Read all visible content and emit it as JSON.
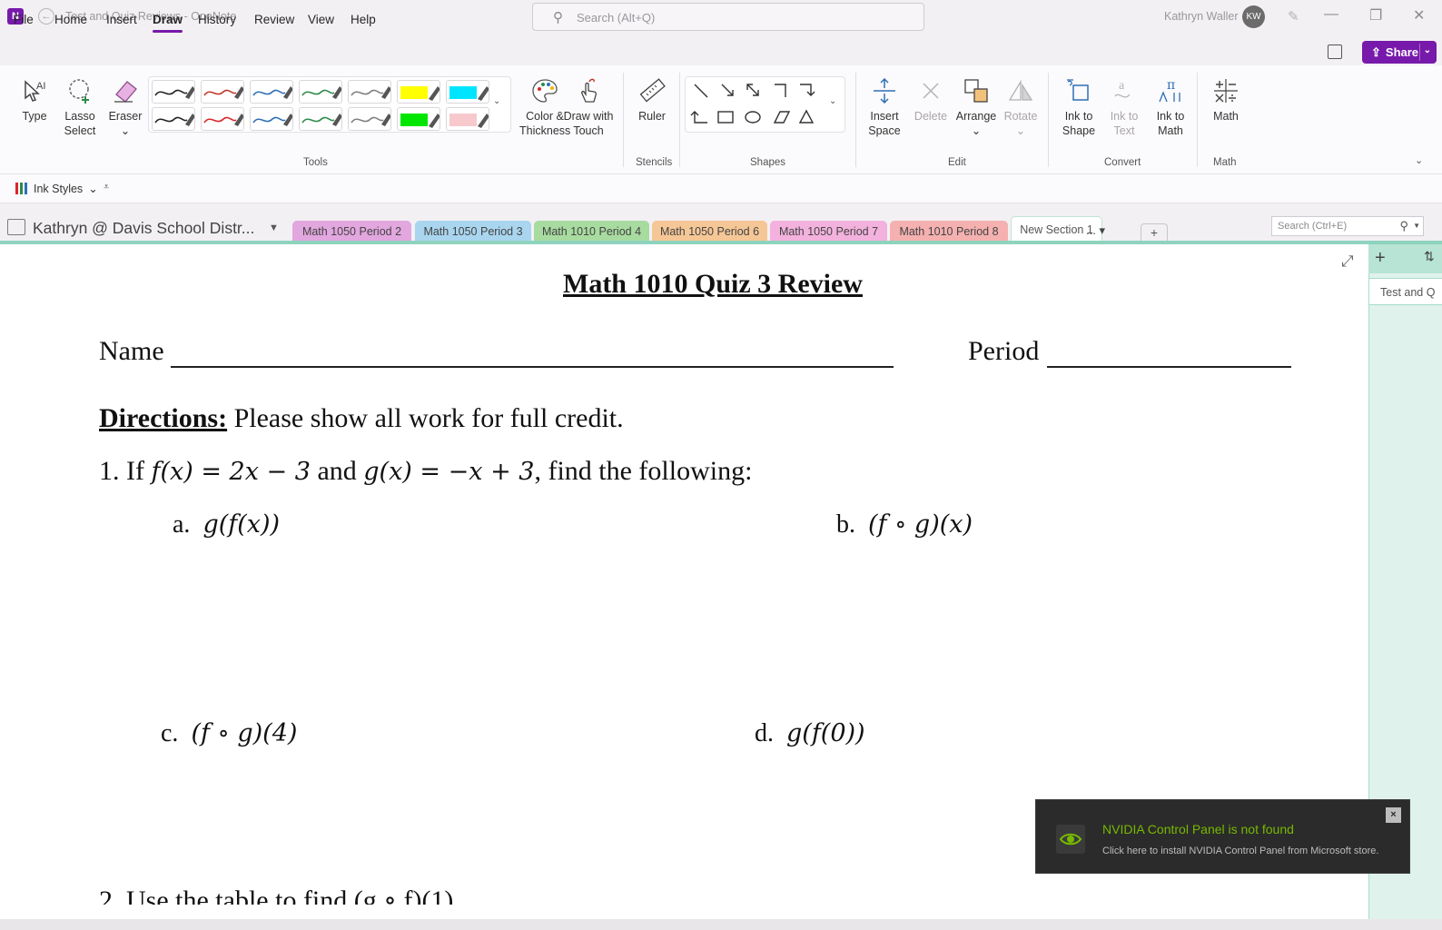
{
  "window": {
    "title": "Test and Quiz Reviews - OneNote",
    "app_icon_letter": "N",
    "search_placeholder": "Search (Alt+Q)",
    "user_name": "Kathryn Waller",
    "user_initials": "KW"
  },
  "menu": {
    "items": [
      "File",
      "Home",
      "Insert",
      "Draw",
      "History",
      "Review",
      "View",
      "Help"
    ],
    "active": "Draw",
    "share_label": "Share"
  },
  "ribbon": {
    "tools": {
      "type_label": "Type",
      "lasso_label": "Lasso Select",
      "eraser_label": "Eraser",
      "group_label": "Tools",
      "pens": [
        {
          "color": "#222222"
        },
        {
          "color": "#c0392b"
        },
        {
          "color": "#2e6fb5"
        },
        {
          "color": "#2d8a4a"
        },
        {
          "color": "#7f7f7f"
        },
        {
          "color": "#ffff00",
          "highlighter": true
        },
        {
          "color": "#00e5ff",
          "highlighter": true
        },
        {
          "color": "#222222"
        },
        {
          "color": "#d9262b"
        },
        {
          "color": "#2e6fb5"
        },
        {
          "color": "#2d8a4a"
        },
        {
          "color": "#7f7f7f"
        },
        {
          "color": "#00e600",
          "highlighter": true
        },
        {
          "color": "#f7c9cd",
          "highlighter": true
        }
      ],
      "color_thickness_label": "Color & Thickness",
      "draw_touch_label": "Draw with Touch"
    },
    "stencils": {
      "ruler_label": "Ruler",
      "group_label": "Stencils"
    },
    "shapes": {
      "group_label": "Shapes"
    },
    "edit": {
      "insert_space_label": "Insert Space",
      "delete_label": "Delete",
      "arrange_label": "Arrange",
      "rotate_label": "Rotate",
      "group_label": "Edit"
    },
    "convert": {
      "ink_shape_label": "Ink to Shape",
      "ink_text_label": "Ink to Text",
      "ink_math_label": "Ink to Math",
      "group_label": "Convert"
    },
    "math": {
      "math_label": "Math",
      "group_label": "Math"
    }
  },
  "qab": {
    "ink_styles_label": "Ink Styles"
  },
  "notebook": {
    "name": "Kathryn @ Davis School Distr...",
    "sections": [
      {
        "label": "Math 1050 Period 2",
        "color": "#e2a7df"
      },
      {
        "label": "Math 1050 Period 3",
        "color": "#a9d5ef"
      },
      {
        "label": "Math 1010 Period 4",
        "color": "#a8dba0"
      },
      {
        "label": "Math 1050 Period 6",
        "color": "#f6c796"
      },
      {
        "label": "Math 1050 Period 7",
        "color": "#f3b2dd"
      },
      {
        "label": "Math 1010 Period 8",
        "color": "#f5b0b0"
      },
      {
        "label": "New Section 1",
        "color": "#ffffff",
        "active": true
      }
    ],
    "more_label": "...",
    "add_label": "+",
    "page_search_placeholder": "Search (Ctrl+E)"
  },
  "page_pane": {
    "add_icon": "+",
    "pages": [
      "Test and Q"
    ]
  },
  "page": {
    "title": "Math 1010 Quiz 3 Review",
    "name_label": "Name",
    "period_label": "Period",
    "directions_label": "Directions:",
    "directions_text": " Please show all work for full credit.",
    "q1_number": "1.  If ",
    "q1_f": "f(x) = 2x − 3",
    "q1_and": " and ",
    "q1_g": "g(x) = −x + 3",
    "q1_tail": ", find the following:",
    "qa_label": "a.",
    "qa_expr": "g(f(x))",
    "qb_label": "b.",
    "qb_expr": "(f ∘ g)(x)",
    "qc_label": "c.",
    "qc_expr": "(f ∘ g)(4)",
    "qd_label": "d.",
    "qd_expr": "g(f(0))",
    "q2_text": "2. Use the table to find (g ∘ f)(1)"
  },
  "toast": {
    "title": "NVIDIA Control Panel is not found",
    "body": "Click here to install NVIDIA Control Panel from Microsoft store.",
    "close_icon": "×"
  }
}
